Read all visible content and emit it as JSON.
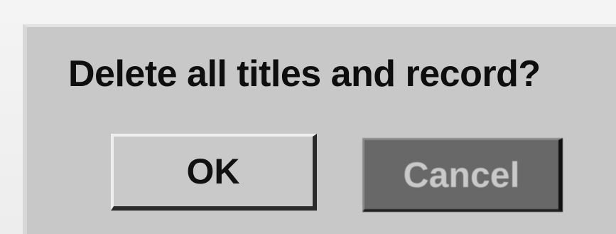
{
  "dialog": {
    "message": "Delete all titles and record?",
    "buttons": {
      "ok_label": "OK",
      "cancel_label": "Cancel"
    }
  }
}
